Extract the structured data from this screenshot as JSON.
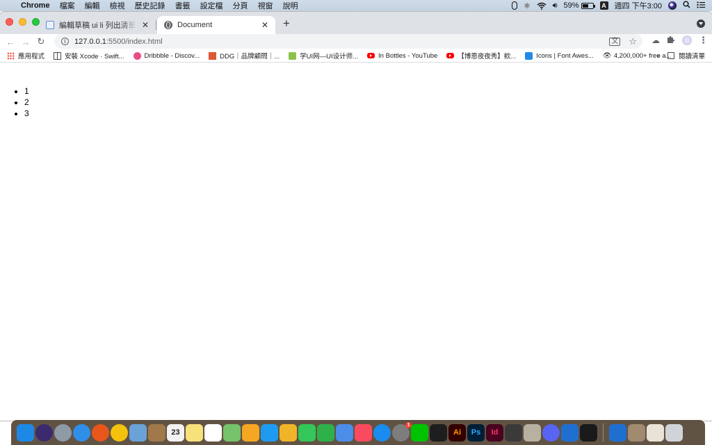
{
  "menubar": {
    "app_name": "Chrome",
    "items": [
      "檔案",
      "編輯",
      "檢視",
      "歷史記錄",
      "書籤",
      "設定檔",
      "分頁",
      "視窗",
      "說明"
    ],
    "battery_text": "59%",
    "battery_level": 0.59,
    "input_method": "A",
    "clock": "週四 下午3:00"
  },
  "tabs": [
    {
      "title": "編輯草稿 ui li 列出清單標籤-基礎",
      "active": false
    },
    {
      "title": "Document",
      "active": true
    }
  ],
  "toolbar": {
    "url_host": "127.0.0.1",
    "url_path": ":5500/index.html"
  },
  "bookmarks": [
    {
      "label": "應用程式",
      "icon": "apps-grid-icon"
    },
    {
      "label": "安裝 Xcode · Swift...",
      "icon": "book-icon"
    },
    {
      "label": "Dribbble - Discov...",
      "icon": "dribbble-icon"
    },
    {
      "label": "DDG｜品牌顧問｜...",
      "icon": "ddg-icon"
    },
    {
      "label": "学UI网—UI设计师...",
      "icon": "uisdc-icon"
    },
    {
      "label": "In Bottles - YouTube",
      "icon": "youtube-icon"
    },
    {
      "label": "【博恩夜夜秀】欸...",
      "icon": "youtube-icon"
    },
    {
      "label": "Icons | Font Awes...",
      "icon": "flag-icon"
    },
    {
      "label": "4,200,000+ free a...",
      "icon": "eye-icon"
    }
  ],
  "bookmarks_more": "»",
  "reading_list": "閱讀清單",
  "page": {
    "list_items": [
      "1",
      "2",
      "3"
    ]
  },
  "dock": {
    "apps": [
      {
        "name": "finder-icon",
        "color": "#1e88e5",
        "label": ""
      },
      {
        "name": "siri-icon",
        "color": "#3b2a6e",
        "label": ""
      },
      {
        "name": "launchpad-icon",
        "color": "#8e9aa6",
        "label": ""
      },
      {
        "name": "safari-icon",
        "color": "#2f8fe8",
        "label": ""
      },
      {
        "name": "firefox-icon",
        "color": "#e8561c",
        "label": ""
      },
      {
        "name": "chrome-icon",
        "color": "#f4c20d",
        "label": ""
      },
      {
        "name": "preview-icon",
        "color": "#6aa2d8",
        "label": ""
      },
      {
        "name": "notebook-icon",
        "color": "#a0784a",
        "label": ""
      },
      {
        "name": "calendar-icon",
        "color": "#f2f2f2",
        "label": "23"
      },
      {
        "name": "notes-icon",
        "color": "#f7e27a",
        "label": ""
      },
      {
        "name": "reminders-icon",
        "color": "#ffffff",
        "label": ""
      },
      {
        "name": "maps-icon",
        "color": "#76c36b",
        "label": ""
      },
      {
        "name": "photos-icon",
        "color": "#f5a623",
        "label": ""
      },
      {
        "name": "messages-cloud-icon",
        "color": "#1e9bf0",
        "label": ""
      },
      {
        "name": "keynote-icon",
        "color": "#f0b429",
        "label": ""
      },
      {
        "name": "facetime-icon",
        "color": "#34c759",
        "label": ""
      },
      {
        "name": "numbers-icon",
        "color": "#2fb14a",
        "label": ""
      },
      {
        "name": "keynote-podium-icon",
        "color": "#4b8de8",
        "label": ""
      },
      {
        "name": "music-icon",
        "color": "#fa4a5f",
        "label": ""
      },
      {
        "name": "app-store-icon",
        "color": "#1a8cf0",
        "label": ""
      },
      {
        "name": "system-preferences-icon",
        "color": "#7d7d7d",
        "label": "",
        "badge": "1"
      },
      {
        "name": "line-icon",
        "color": "#00c300",
        "label": ""
      },
      {
        "name": "figma-icon",
        "color": "#1e1e1e",
        "label": ""
      },
      {
        "name": "illustrator-icon",
        "color": "#330000",
        "label": "Ai",
        "text_color": "#ff9a00"
      },
      {
        "name": "photoshop-icon",
        "color": "#001e36",
        "label": "Ps",
        "text_color": "#31a8ff"
      },
      {
        "name": "indesign-icon",
        "color": "#49021f",
        "label": "Id",
        "text_color": "#ff3366"
      },
      {
        "name": "final-cut-icon",
        "color": "#3a3a3a",
        "label": ""
      },
      {
        "name": "utility-icon",
        "color": "#b8b0a0",
        "label": ""
      },
      {
        "name": "discord-icon",
        "color": "#5865f2",
        "label": ""
      },
      {
        "name": "vscode-icon",
        "color": "#1f6fd1",
        "label": ""
      },
      {
        "name": "terminal-icon",
        "color": "#1a1a1a",
        "label": ""
      }
    ],
    "recent": [
      {
        "name": "vscode-recent-icon",
        "color": "#1f6fd1",
        "label": ""
      },
      {
        "name": "disk-icon",
        "color": "#a08a70",
        "label": ""
      },
      {
        "name": "document-icon",
        "color": "#e8e3d6",
        "label": ""
      },
      {
        "name": "trash-icon",
        "color": "#d0d4d8",
        "label": ""
      }
    ]
  },
  "colors": {
    "tabstrip": "#dee1e6",
    "omnibox": "#f1f3f4",
    "dock": "#544434"
  }
}
